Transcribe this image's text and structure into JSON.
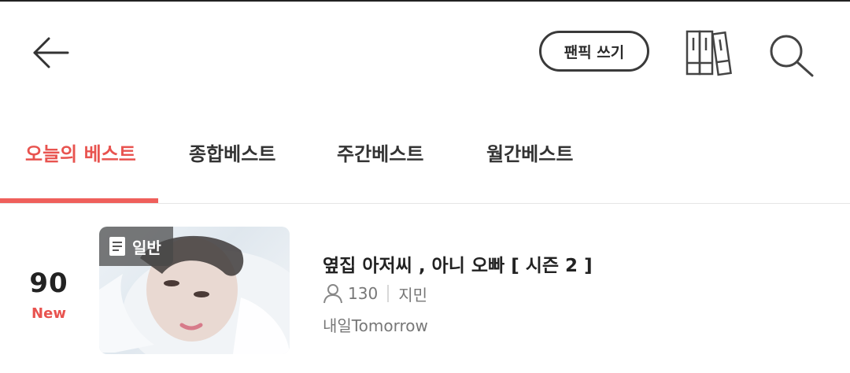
{
  "header": {
    "write_button_label": "팬픽 쓰기",
    "icons": [
      "back-arrow-icon",
      "library-books-icon",
      "search-icon"
    ]
  },
  "tabs": [
    {
      "label": "오늘의 베스트",
      "active": true
    },
    {
      "label": "종합베스트",
      "active": false
    },
    {
      "label": "주간베스트",
      "active": false
    },
    {
      "label": "월간베스트",
      "active": false
    }
  ],
  "list": [
    {
      "rank": "90",
      "rank_badge": "New",
      "genre": "일반",
      "title": "옆집 아저씨 , 아니 오빠 [ 시즌 2 ]",
      "subscribers": "130",
      "character": "지민",
      "author": "내일Tomorrow"
    }
  ],
  "colors": {
    "accent": "#e8534f",
    "text": "#222222",
    "muted": "#777777"
  }
}
